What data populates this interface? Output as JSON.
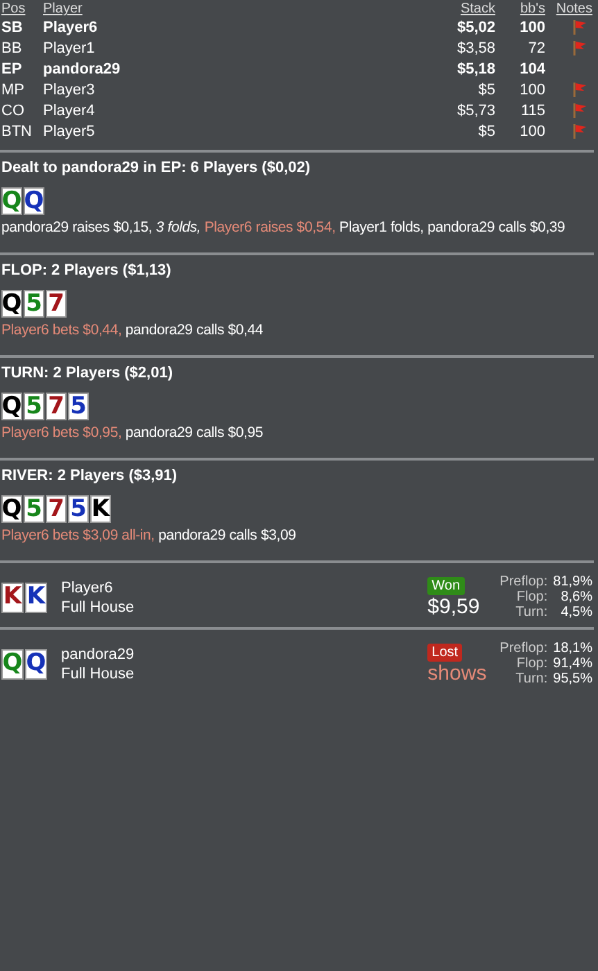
{
  "players": {
    "columns": [
      "Pos",
      "Player",
      "Stack",
      "bb's",
      "Notes"
    ],
    "rows": [
      {
        "pos": "SB",
        "player": "Player6",
        "stack": "$5,02",
        "bbs": "100",
        "highlighted": true,
        "note": true
      },
      {
        "pos": "BB",
        "player": "Player1",
        "stack": "$3,58",
        "bbs": "72",
        "highlighted": false,
        "note": true
      },
      {
        "pos": "EP",
        "player": "pandora29",
        "stack": "$5,18",
        "bbs": "104",
        "highlighted": true,
        "note": false
      },
      {
        "pos": "MP",
        "player": "Player3",
        "stack": "$5",
        "bbs": "100",
        "highlighted": false,
        "note": true
      },
      {
        "pos": "CO",
        "player": "Player4",
        "stack": "$5,73",
        "bbs": "115",
        "highlighted": false,
        "note": true
      },
      {
        "pos": "BTN",
        "player": "Player5",
        "stack": "$5",
        "bbs": "100",
        "highlighted": false,
        "note": true
      }
    ]
  },
  "streets": [
    {
      "title": "Dealt to pandora29 in EP: 6 Players ($0,02)",
      "cards": [
        {
          "rank": "Q",
          "color": "#17861b"
        },
        {
          "rank": "Q",
          "color": "#1632b8"
        }
      ],
      "actions": [
        {
          "kind": "normal",
          "text": "pandora29 raises $0,15,"
        },
        {
          "kind": "italic",
          "text": "3 folds,"
        },
        {
          "kind": "highlight",
          "text": "Player6 raises $0,54,"
        },
        {
          "kind": "normal",
          "text": "Player1 folds, pandora29 calls $0,39"
        }
      ]
    },
    {
      "title": "FLOP: 2 Players ($1,13)",
      "cards": [
        {
          "rank": "Q",
          "color": "#000000"
        },
        {
          "rank": "5",
          "color": "#17861b"
        },
        {
          "rank": "7",
          "color": "#a3161b"
        }
      ],
      "actions": [
        {
          "kind": "highlight",
          "text": "Player6 bets $0,44,"
        },
        {
          "kind": "normal",
          "text": "pandora29 calls $0,44"
        }
      ]
    },
    {
      "title": "TURN: 2 Players ($2,01)",
      "cards": [
        {
          "rank": "Q",
          "color": "#000000"
        },
        {
          "rank": "5",
          "color": "#17861b"
        },
        {
          "rank": "7",
          "color": "#a3161b"
        },
        {
          "rank": "5",
          "color": "#1632b8"
        }
      ],
      "actions": [
        {
          "kind": "highlight",
          "text": "Player6 bets $0,95,"
        },
        {
          "kind": "normal",
          "text": "pandora29 calls $0,95"
        }
      ]
    },
    {
      "title": "RIVER: 2 Players ($3,91)",
      "cards": [
        {
          "rank": "Q",
          "color": "#000000"
        },
        {
          "rank": "5",
          "color": "#17861b"
        },
        {
          "rank": "7",
          "color": "#a3161b"
        },
        {
          "rank": "5",
          "color": "#1632b8"
        },
        {
          "rank": "K",
          "color": "#000000"
        }
      ],
      "actions": [
        {
          "kind": "highlight",
          "text": "Player6 bets $3,09 all-in,"
        },
        {
          "kind": "normal",
          "text": "pandora29 calls $3,09"
        }
      ]
    }
  ],
  "results": [
    {
      "cards": [
        {
          "rank": "K",
          "color": "#a3161b"
        },
        {
          "rank": "K",
          "color": "#1632b8"
        }
      ],
      "player": "Player6",
      "hand": "Full House",
      "kind": "won",
      "badge": "Won",
      "amount": "$9,59",
      "equity": [
        {
          "label": "Preflop:",
          "value": "81,9%"
        },
        {
          "label": "Flop:",
          "value": "8,6%"
        },
        {
          "label": "Turn:",
          "value": "4,5%"
        }
      ]
    },
    {
      "cards": [
        {
          "rank": "Q",
          "color": "#17861b"
        },
        {
          "rank": "Q",
          "color": "#1632b8"
        }
      ],
      "player": "pandora29",
      "hand": "Full House",
      "kind": "lost",
      "badge": "Lost",
      "amount": "shows",
      "equity": [
        {
          "label": "Preflop:",
          "value": "18,1%"
        },
        {
          "label": "Flop:",
          "value": "91,4%"
        },
        {
          "label": "Turn:",
          "value": "95,5%"
        }
      ]
    }
  ]
}
